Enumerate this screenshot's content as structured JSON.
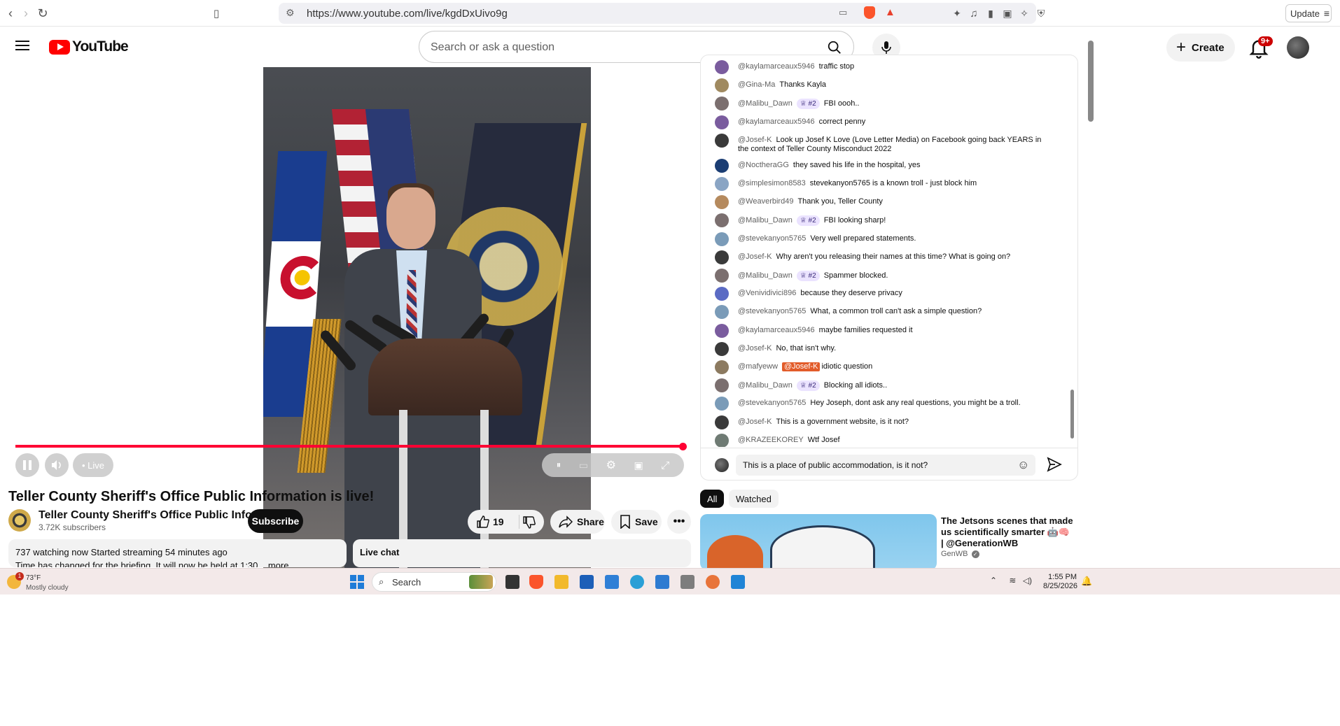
{
  "browser": {
    "url": "https://www.youtube.com/live/kgdDxUivo9g",
    "update_label": "Update"
  },
  "header": {
    "logo_text": "YouTube",
    "search_placeholder": "Search or ask a question",
    "create_label": "Create",
    "notification_count": "9+"
  },
  "player": {
    "live_label": "• Live",
    "progress_fraction": 1.0
  },
  "video": {
    "title": "Teller County Sheriff's Office Public Information is live!",
    "channel_name": "Teller County Sheriff's Office Public Information",
    "subscribers": "3.72K subscribers",
    "subscribe_label": "Subscribe",
    "likes": "19",
    "share_label": "Share",
    "save_label": "Save",
    "stats_line": "737 watching now  Started streaming 54 minutes ago",
    "description_line": "Time has changed for the briefing. It will now be held at 1:30 ...more",
    "live_chat_label": "Live chat"
  },
  "chat": {
    "messages": [
      {
        "author": "@kaylamarceaux5946",
        "text": "traffic stop"
      },
      {
        "author": "@Gina-Ma",
        "text": "Thanks Kayla"
      },
      {
        "author": "@Malibu_Dawn",
        "badge": "♕ #2",
        "text": "FBI oooh.."
      },
      {
        "author": "@kaylamarceaux5946",
        "text": "correct penny"
      },
      {
        "author": "@Josef-K",
        "text": "Look up Josef K Love (Love Letter Media) on Facebook going back YEARS in the context of Teller County Misconduct 2022"
      },
      {
        "author": "@NoctheraGG",
        "text": "they saved his life in the hospital, yes"
      },
      {
        "author": "@simplesimon8583",
        "text": "stevekanyon5765 is a known troll - just block him"
      },
      {
        "author": "@Weaverbird49",
        "text": "Thank you, Teller County"
      },
      {
        "author": "@Malibu_Dawn",
        "badge": "♕ #2",
        "text": "FBI looking sharp!"
      },
      {
        "author": "@stevekanyon5765",
        "text": "Very well prepared statements."
      },
      {
        "author": "@Josef-K",
        "text": "Why aren't you releasing their names at this time? What is going on?"
      },
      {
        "author": "@Malibu_Dawn",
        "badge": "♕ #2",
        "text": "Spammer blocked."
      },
      {
        "author": "@Venividivici896",
        "text": "because they deserve privacy"
      },
      {
        "author": "@stevekanyon5765",
        "text": "What, a common troll can't ask a simple question?"
      },
      {
        "author": "@kaylamarceaux5946",
        "text": "maybe families requested it"
      },
      {
        "author": "@Josef-K",
        "text": "No, that isn't why."
      },
      {
        "author": "@mafyeww",
        "mention": "@Josef-K",
        "text": "idiotic question"
      },
      {
        "author": "@Malibu_Dawn",
        "badge": "♕ #2",
        "text": "Blocking all idiots.."
      },
      {
        "author": "@stevekanyon5765",
        "text": "Hey Joseph, dont ask any real questions, you might be a troll."
      },
      {
        "author": "@Josef-K",
        "text": "This is a government website, is it not?"
      },
      {
        "author": "@KRAZEEKOREY",
        "text": "Wtf Josef"
      }
    ],
    "input_value": "This is a place of public accommodation, is it not?"
  },
  "recommendations": {
    "chip_all": "All",
    "chip_watched": "Watched",
    "items": [
      {
        "title": "The Jetsons scenes that made us scientifically smarter 🤖🧠 | @GenerationWB",
        "channel": "GenWB"
      }
    ]
  },
  "taskbar": {
    "temperature": "73°F",
    "condition": "Mostly cloudy",
    "alert_count": "1",
    "search_label": "Search",
    "time": "1:55 PM",
    "date": "8/25/2026"
  },
  "colors": {
    "accent_red": "#ff0033",
    "youtube_red": "#ff0000",
    "mention_orange": "#e25c2a",
    "badge_purple": "#ebe3ff"
  }
}
